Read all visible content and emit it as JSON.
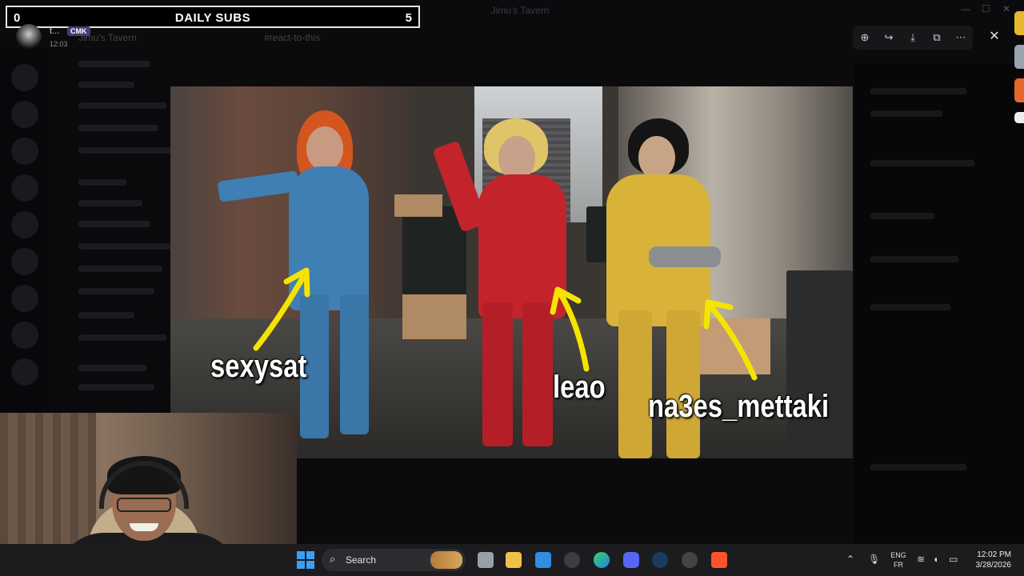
{
  "overlay": {
    "subs_left": "0",
    "subs_title": "DAILY SUBS",
    "subs_right": "5"
  },
  "message": {
    "author": "t...",
    "tag": "CMK",
    "time": "12:03"
  },
  "discord": {
    "window_title": "Jimu's Tavern",
    "server_name": "Jimu's Tavern",
    "channel": "#react-to-this"
  },
  "image_labels": {
    "left": "sexysat",
    "middle": "leao",
    "right": "na3es_mettaki"
  },
  "taskbar": {
    "search_label": "Search",
    "lang_top": "ENG",
    "lang_bottom": "FR",
    "time": "12:02 PM",
    "date": "3/28/2026"
  },
  "icons": {
    "start": "windows-start-icon",
    "search": "search-icon",
    "close": "close-icon"
  },
  "colors": {
    "suit_blue": "#3f7fb3",
    "suit_red": "#c3242c",
    "suit_yellow": "#d9b23a",
    "arrow_yellow": "#f5e400",
    "hud_border": "#e6e6e6"
  }
}
